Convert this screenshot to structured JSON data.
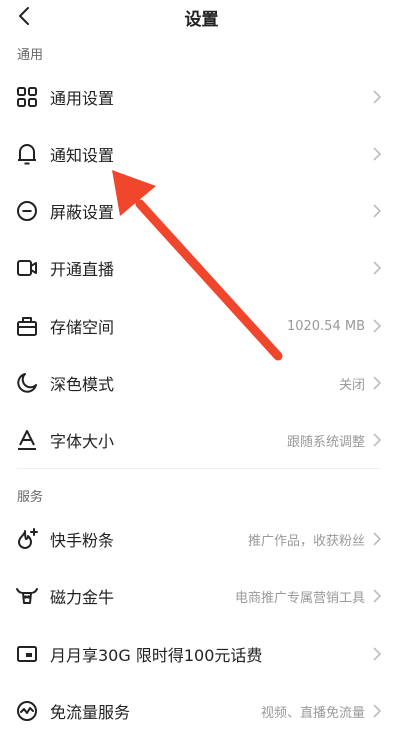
{
  "header": {
    "title": "设置"
  },
  "sections": [
    {
      "label": "通用",
      "items": [
        {
          "label": "通用设置",
          "value": "",
          "icon": "grid-icon"
        },
        {
          "label": "通知设置",
          "value": "",
          "icon": "bell-icon"
        },
        {
          "label": "屏蔽设置",
          "value": "",
          "icon": "block-icon"
        },
        {
          "label": "开通直播",
          "value": "",
          "icon": "video-icon"
        },
        {
          "label": "存储空间",
          "value": "1020.54 MB",
          "icon": "storage-icon"
        },
        {
          "label": "深色模式",
          "value": "关闭",
          "icon": "moon-icon"
        },
        {
          "label": "字体大小",
          "value": "跟随系统调整",
          "icon": "font-size-icon"
        }
      ]
    },
    {
      "label": "服务",
      "items": [
        {
          "label": "快手粉条",
          "value": "推广作品，收获粉丝",
          "icon": "flame-plus-icon"
        },
        {
          "label": "磁力金牛",
          "value": "电商推广专属营销工具",
          "icon": "bull-icon"
        },
        {
          "label": "月月享30G 限时得100元话费",
          "value": "",
          "icon": "card-icon"
        },
        {
          "label": "免流量服务",
          "value": "视频、直播免流量",
          "icon": "data-free-icon"
        }
      ]
    }
  ],
  "colors": {
    "annotation_arrow": "#f0462c",
    "divider": "#eeeeee",
    "value_text": "#9a9a9a"
  }
}
